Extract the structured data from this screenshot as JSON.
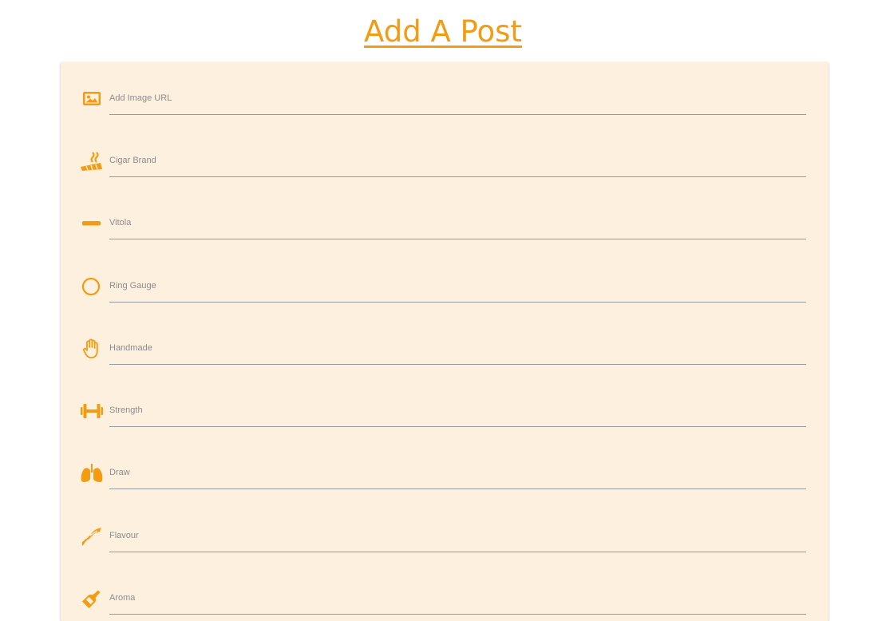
{
  "header": {
    "title": "Add A Post"
  },
  "form": {
    "fields": [
      {
        "label": "Add Image URL",
        "icon": "image-icon"
      },
      {
        "label": "Cigar Brand",
        "icon": "cigar-smoke-icon"
      },
      {
        "label": "Vitola",
        "icon": "minus-bar-icon"
      },
      {
        "label": "Ring Gauge",
        "icon": "circle-outline-icon"
      },
      {
        "label": "Handmade",
        "icon": "hand-icon"
      },
      {
        "label": "Strength",
        "icon": "dumbbell-icon"
      },
      {
        "label": "Draw",
        "icon": "lungs-icon"
      },
      {
        "label": "Flavour",
        "icon": "bacon-icon"
      },
      {
        "label": "Aroma",
        "icon": "wine-bottle-icon"
      }
    ]
  },
  "colors": {
    "accent": "#f39c12",
    "card_background": "#fef0de",
    "label_text": "#8c8c8c",
    "underline": "#9a9a9a"
  }
}
